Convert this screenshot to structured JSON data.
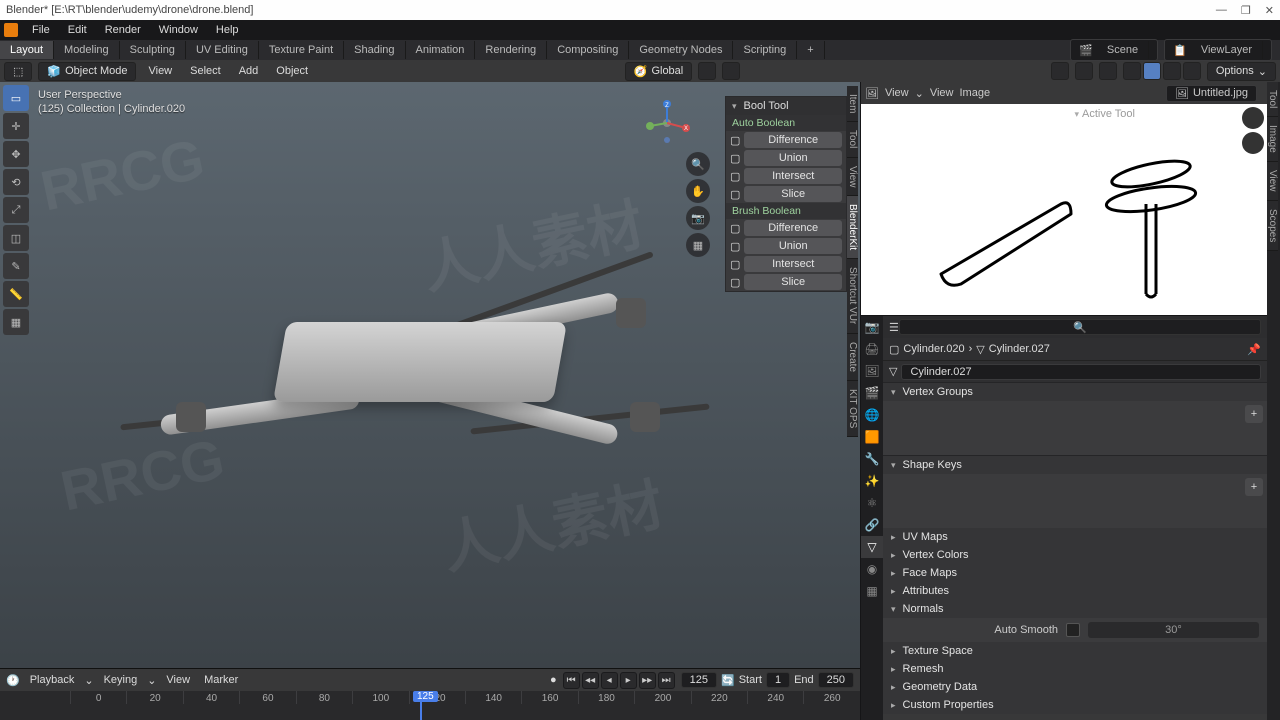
{
  "title": "Blender* [E:\\RT\\blender\\udemy\\drone\\drone.blend]",
  "topmenu": [
    "File",
    "Edit",
    "Render",
    "Window",
    "Help"
  ],
  "workspaces": [
    "Layout",
    "Modeling",
    "Sculpting",
    "UV Editing",
    "Texture Paint",
    "Shading",
    "Animation",
    "Rendering",
    "Compositing",
    "Geometry Nodes",
    "Scripting",
    "+"
  ],
  "workspace_active": "Layout",
  "scene_label": "Scene",
  "viewlayer_label": "ViewLayer",
  "viewport_header": {
    "mode": "Object Mode",
    "menus": [
      "View",
      "Select",
      "Add",
      "Object"
    ],
    "orientation": "Global",
    "options": "Options"
  },
  "overlay": {
    "line1": "User Perspective",
    "line2": "(125) Collection | Cylinder.020"
  },
  "npanel": {
    "title": "Bool Tool",
    "auto_label": "Auto Boolean",
    "brush_label": "Brush Boolean",
    "ops": [
      "Difference",
      "Union",
      "Intersect",
      "Slice"
    ]
  },
  "ntabs": [
    "Item",
    "Tool",
    "View",
    "BlenderKit",
    "Shortcut VUr",
    "Create",
    "KIT OPS"
  ],
  "active_tool": "Active Tool",
  "image_header": {
    "menus": [
      "View",
      "Image"
    ],
    "file": "Untitled.jpg"
  },
  "itabs": [
    "Tool",
    "Image",
    "View",
    "Scopes"
  ],
  "breadcrumb": {
    "a": "Cylinder.020",
    "b": "Cylinder.027"
  },
  "object_selected": "Cylinder.027",
  "panels": {
    "vertex_groups": "Vertex Groups",
    "shape_keys": "Shape Keys",
    "uv_maps": "UV Maps",
    "vertex_colors": "Vertex Colors",
    "face_maps": "Face Maps",
    "attributes": "Attributes",
    "normals": "Normals",
    "autosmooth": "Auto Smooth",
    "autosmooth_val": "30°",
    "texture_space": "Texture Space",
    "remesh": "Remesh",
    "geometry_data": "Geometry Data",
    "custom_props": "Custom Properties"
  },
  "timeline": {
    "menus": [
      "Playback",
      "Keying",
      "View",
      "Marker"
    ],
    "current": "125",
    "start_label": "Start",
    "start": "1",
    "end_label": "End",
    "end": "250",
    "ticks": [
      "0",
      "20",
      "40",
      "60",
      "80",
      "100",
      "120",
      "140",
      "160",
      "180",
      "200",
      "220",
      "240",
      "260"
    ]
  }
}
